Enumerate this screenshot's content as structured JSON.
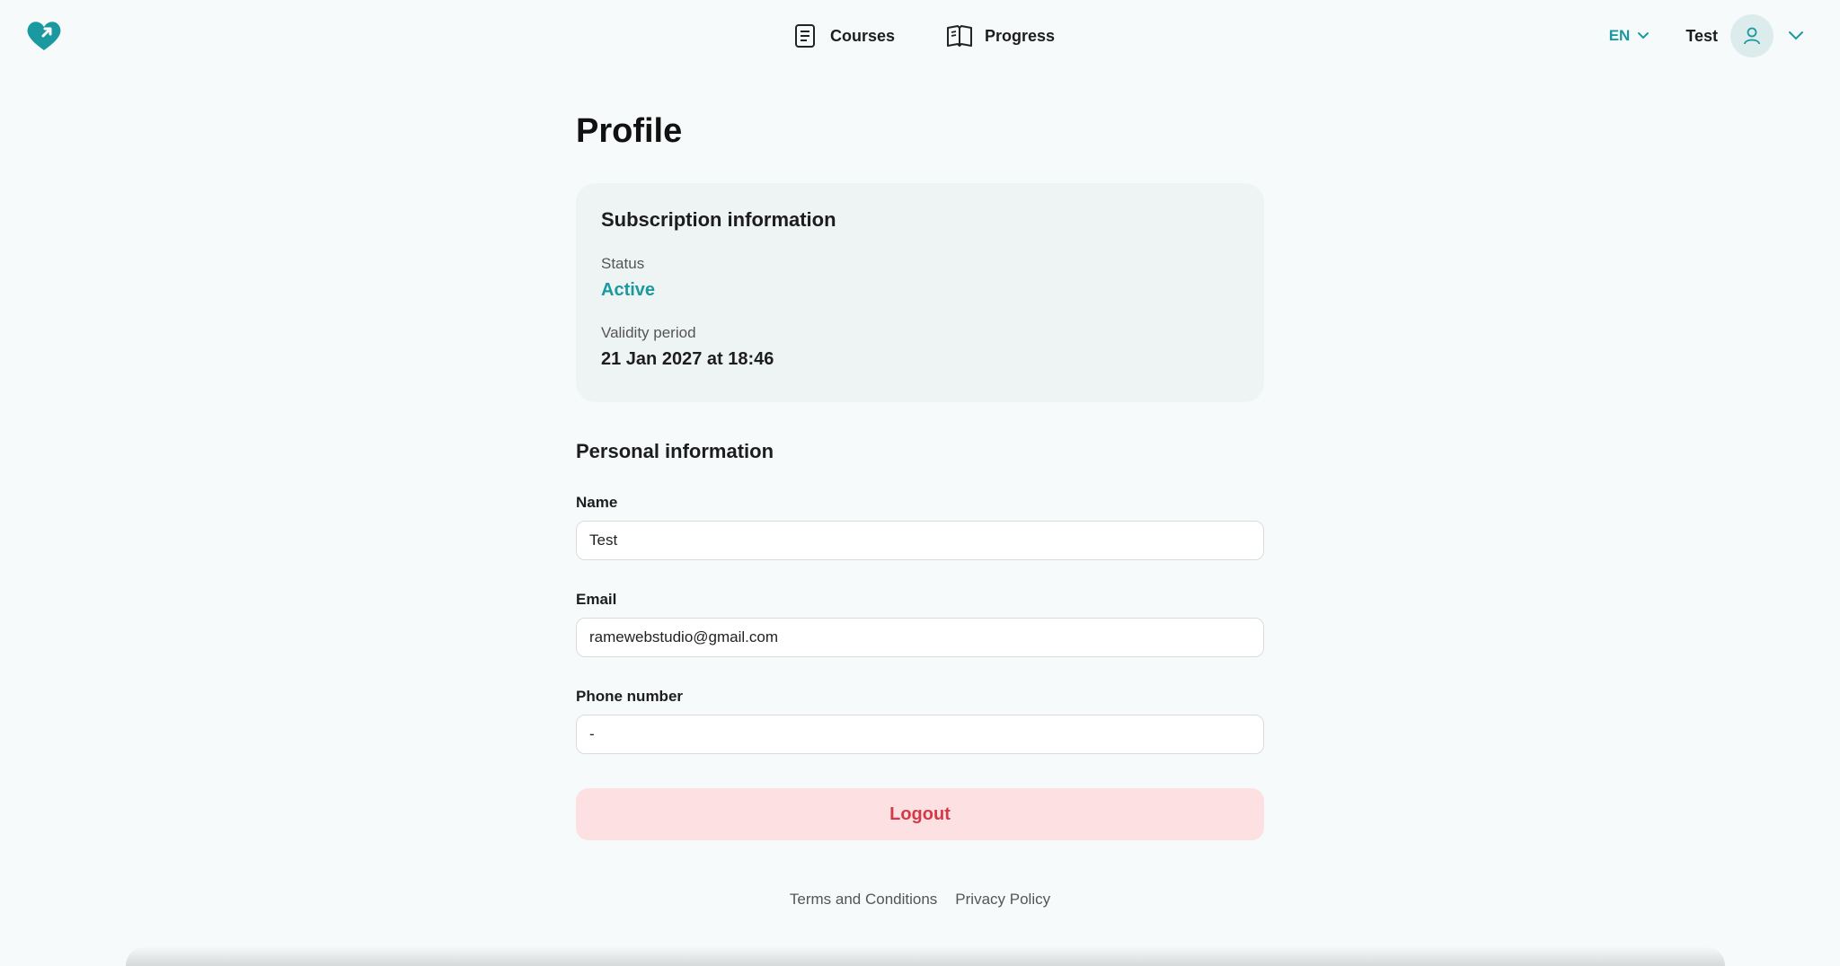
{
  "nav": {
    "courses_label": "Courses",
    "progress_label": "Progress",
    "courses_icon": "document-list-icon",
    "progress_icon": "open-book-icon"
  },
  "header": {
    "language": "EN",
    "user_name": "Test",
    "logo_icon": "heart-logo-icon",
    "accent_color": "#1a9aa0"
  },
  "page": {
    "title": "Profile"
  },
  "subscription": {
    "title": "Subscription information",
    "status_label": "Status",
    "status_value": "Active",
    "validity_label": "Validity period",
    "validity_value": "21 Jan 2027 at 18:46"
  },
  "personal": {
    "title": "Personal information",
    "name_label": "Name",
    "name_value": "Test",
    "email_label": "Email",
    "email_value": "ramewebstudio@gmail.com",
    "phone_label": "Phone number",
    "phone_value": "-"
  },
  "actions": {
    "logout_label": "Logout"
  },
  "footer": {
    "terms_label": "Terms and Conditions",
    "privacy_label": "Privacy Policy"
  }
}
